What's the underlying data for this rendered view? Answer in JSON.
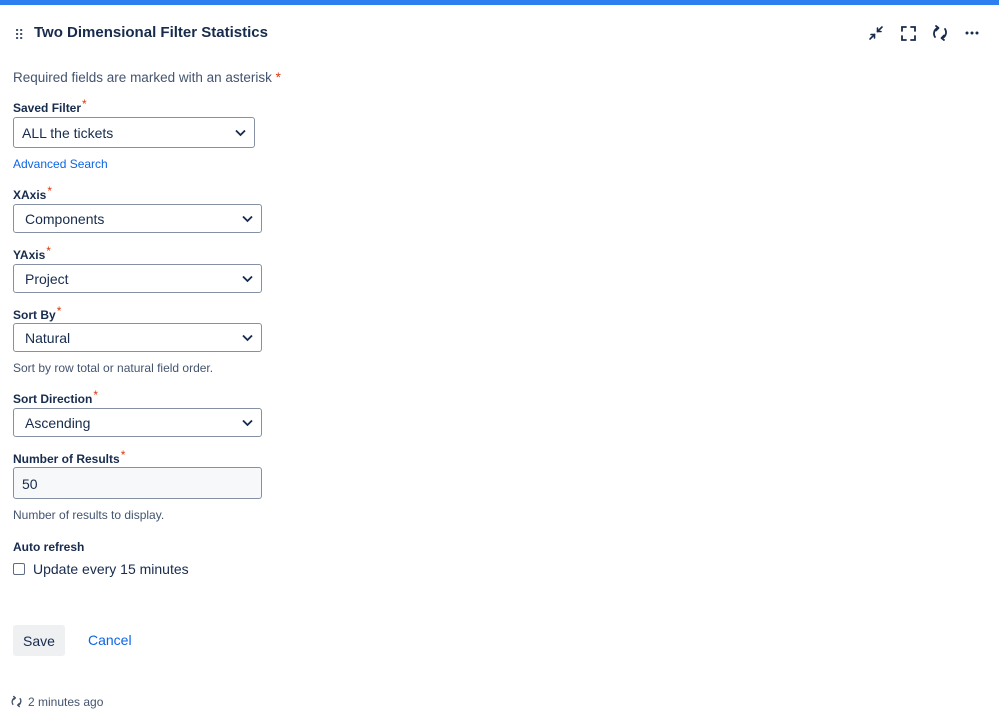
{
  "gadget": {
    "title": "Two Dimensional Filter Statistics",
    "icons": [
      "drag-handle-icon",
      "minimize-icon",
      "maximize-icon",
      "refresh-icon",
      "more-icon"
    ]
  },
  "form": {
    "required_note": "Required fields are marked with an asterisk",
    "required_star": "*",
    "saved_filter": {
      "label": "Saved Filter",
      "value": "ALL the tickets"
    },
    "advanced_search": "Advanced Search",
    "xaxis": {
      "label": "XAxis",
      "value": "Components"
    },
    "yaxis": {
      "label": "YAxis",
      "value": "Project"
    },
    "sort_by": {
      "label": "Sort By",
      "value": "Natural",
      "help": "Sort by row total or natural field order."
    },
    "sort_direction": {
      "label": "Sort Direction",
      "value": "Ascending"
    },
    "num_results": {
      "label": "Number of Results",
      "value": "50",
      "help": "Number of results to display."
    },
    "auto_refresh": {
      "label": "Auto refresh",
      "checkbox_label": "Update every 15 minutes",
      "checked": false
    },
    "save_label": "Save",
    "cancel_label": "Cancel"
  },
  "footer": {
    "updated": "2 minutes ago"
  },
  "colors": {
    "accent": "#2d7ff0",
    "link": "#0c66e4",
    "required": "#de350b",
    "text": "#172b4d"
  }
}
